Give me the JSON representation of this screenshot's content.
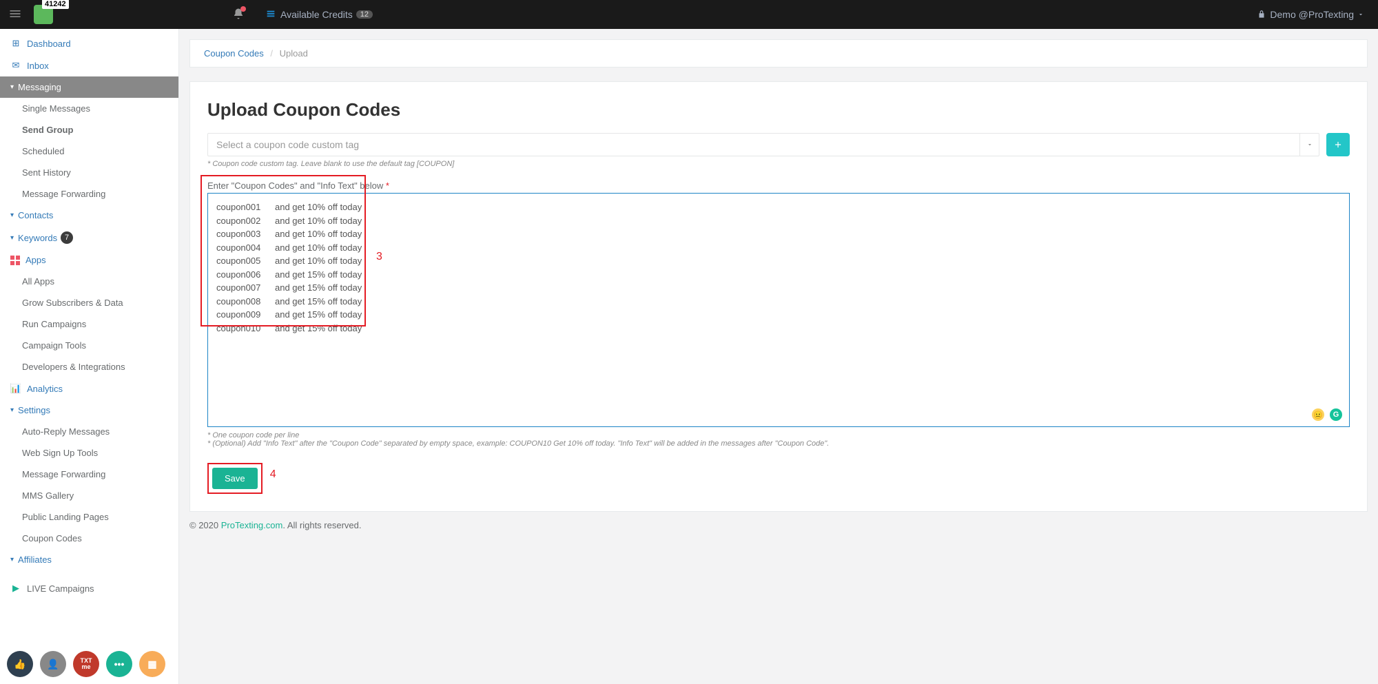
{
  "topbar": {
    "logo_badge": "41242",
    "credits_label": "Available Credits",
    "credits_count": "12",
    "user_label": "Demo @ProTexting"
  },
  "sidebar": {
    "dashboard": "Dashboard",
    "inbox": "Inbox",
    "messaging": "Messaging",
    "messaging_items": {
      "single": "Single Messages",
      "send_group": "Send Group",
      "scheduled": "Scheduled",
      "sent_history": "Sent History",
      "msg_forwarding": "Message Forwarding"
    },
    "contacts": "Contacts",
    "keywords": "Keywords",
    "keywords_badge": "7",
    "apps": "Apps",
    "apps_items": {
      "all_apps": "All Apps",
      "grow": "Grow Subscribers & Data",
      "run": "Run Campaigns",
      "tools": "Campaign Tools",
      "dev": "Developers & Integrations"
    },
    "analytics": "Analytics",
    "settings": "Settings",
    "settings_items": {
      "auto_reply": "Auto-Reply Messages",
      "web_signup": "Web Sign Up Tools",
      "msg_fwd": "Message Forwarding",
      "mms": "MMS Gallery",
      "landing": "Public Landing Pages",
      "coupon": "Coupon Codes"
    },
    "affiliates": "Affiliates",
    "live_campaigns": "LIVE Campaigns"
  },
  "breadcrumb": {
    "parent": "Coupon Codes",
    "current": "Upload"
  },
  "page": {
    "title": "Upload Coupon Codes",
    "tag_placeholder": "Select a coupon code custom tag",
    "tag_help": "* Coupon code custom tag. Leave blank to use the default tag [COUPON]",
    "textarea_label": "Enter \"Coupon Codes\" and \"Info Text\" below",
    "codes": [
      {
        "code": "coupon001",
        "text": "and get 10% off today"
      },
      {
        "code": "coupon002",
        "text": "and get 10% off today"
      },
      {
        "code": "coupon003",
        "text": "and get 10% off today"
      },
      {
        "code": "coupon004",
        "text": "and get 10% off today"
      },
      {
        "code": "coupon005",
        "text": "and get 10% off today"
      },
      {
        "code": "coupon006",
        "text": "and get 15% off today"
      },
      {
        "code": "coupon007",
        "text": "and get 15% off today"
      },
      {
        "code": "coupon008",
        "text": "and get 15% off today"
      },
      {
        "code": "coupon009",
        "text": "and get 15% off today"
      },
      {
        "code": "coupon010",
        "text": "and get 15% off today"
      }
    ],
    "help1": "* One coupon code per line",
    "help2": "* (Optional) Add \"Info Text\" after the \"Coupon Code\" separated by empty space, example: COUPON10 Get 10% off today. \"Info Text\" will be added in the messages after \"Coupon Code\".",
    "save_label": "Save",
    "annotation_3": "3",
    "annotation_4": "4"
  },
  "footer": {
    "copyright": "© 2020 ",
    "link": "ProTexting.com",
    "rights": ". All rights reserved."
  },
  "bottom_icons": {
    "txt": "TXT",
    "me": "me"
  }
}
